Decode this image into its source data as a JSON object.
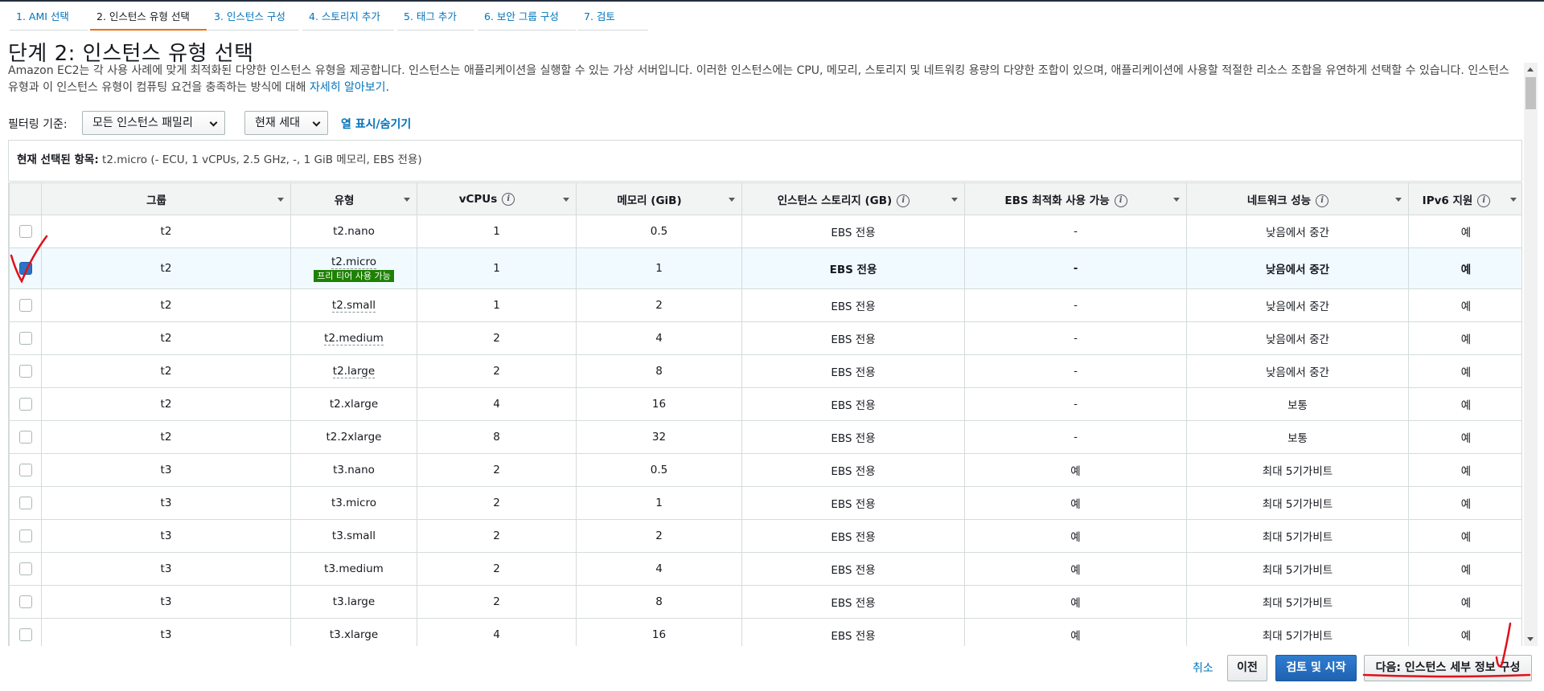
{
  "wizard_steps": [
    {
      "label": "1. AMI 선택"
    },
    {
      "label": "2. 인스턴스 유형 선택"
    },
    {
      "label": "3. 인스턴스 구성"
    },
    {
      "label": "4. 스토리지 추가"
    },
    {
      "label": "5. 태그 추가"
    },
    {
      "label": "6. 보안 그룹 구성"
    },
    {
      "label": "7. 검토"
    }
  ],
  "page": {
    "title": "단계 2: 인스턴스 유형 선택",
    "description": "Amazon EC2는 각 사용 사례에 맞게 최적화된 다양한 인스턴스 유형을 제공합니다. 인스턴스는 애플리케이션을 실행할 수 있는 가상 서버입니다. 이러한 인스턴스에는 CPU, 메모리, 스토리지 및 네트워킹 용량의 다양한 조합이 있으며, 애플리케이션에 사용할 적절한 리소스 조합을 유연하게 선택할 수 있습니다. 인스턴스 유형과 이 인스턴스 유형이 컴퓨팅 요건을 충족하는 방식에 대해 ",
    "learn_more": "자세히 알아보기",
    "desc_end": "."
  },
  "filter": {
    "label": "필터링 기준:",
    "family_select": "모든 인스턴스 패밀리",
    "generation_select": "현재 세대",
    "toggle_columns": "열 표시/숨기기"
  },
  "selected": {
    "label": "현재 선택된 항목:",
    "value": "t2.micro (- ECU, 1 vCPUs, 2.5 GHz, -, 1 GiB 메모리, EBS 전용)"
  },
  "table": {
    "headers": [
      "그룹",
      "유형",
      "vCPUs",
      "메모리 (GiB)",
      "인스턴스 스토리지 (GB)",
      "EBS 최적화 사용 가능",
      "네트워크 성능",
      "IPv6 지원"
    ],
    "info_icon": "i",
    "free_tier_badge": "프리 티어 사용 가능",
    "rows": [
      {
        "group": "t2",
        "type": "t2.nano",
        "vcpus": "1",
        "memory": "0.5",
        "storage": "EBS 전용",
        "ebs": "-",
        "network": "낮음에서 중간",
        "ipv6": "예",
        "selected": false
      },
      {
        "group": "t2",
        "type": "t2.micro",
        "vcpus": "1",
        "memory": "1",
        "storage": "EBS 전용",
        "ebs": "-",
        "network": "낮음에서 중간",
        "ipv6": "예",
        "selected": true
      },
      {
        "group": "t2",
        "type": "t2.small",
        "vcpus": "1",
        "memory": "2",
        "storage": "EBS 전용",
        "ebs": "-",
        "network": "낮음에서 중간",
        "ipv6": "예",
        "selected": false
      },
      {
        "group": "t2",
        "type": "t2.medium",
        "vcpus": "2",
        "memory": "4",
        "storage": "EBS 전용",
        "ebs": "-",
        "network": "낮음에서 중간",
        "ipv6": "예",
        "selected": false
      },
      {
        "group": "t2",
        "type": "t2.large",
        "vcpus": "2",
        "memory": "8",
        "storage": "EBS 전용",
        "ebs": "-",
        "network": "낮음에서 중간",
        "ipv6": "예",
        "selected": false
      },
      {
        "group": "t2",
        "type": "t2.xlarge",
        "vcpus": "4",
        "memory": "16",
        "storage": "EBS 전용",
        "ebs": "-",
        "network": "보통",
        "ipv6": "예",
        "selected": false
      },
      {
        "group": "t2",
        "type": "t2.2xlarge",
        "vcpus": "8",
        "memory": "32",
        "storage": "EBS 전용",
        "ebs": "-",
        "network": "보통",
        "ipv6": "예",
        "selected": false
      },
      {
        "group": "t3",
        "type": "t3.nano",
        "vcpus": "2",
        "memory": "0.5",
        "storage": "EBS 전용",
        "ebs": "예",
        "network": "최대 5기가비트",
        "ipv6": "예",
        "selected": false
      },
      {
        "group": "t3",
        "type": "t3.micro",
        "vcpus": "2",
        "memory": "1",
        "storage": "EBS 전용",
        "ebs": "예",
        "network": "최대 5기가비트",
        "ipv6": "예",
        "selected": false
      },
      {
        "group": "t3",
        "type": "t3.small",
        "vcpus": "2",
        "memory": "2",
        "storage": "EBS 전용",
        "ebs": "예",
        "network": "최대 5기가비트",
        "ipv6": "예",
        "selected": false
      },
      {
        "group": "t3",
        "type": "t3.medium",
        "vcpus": "2",
        "memory": "4",
        "storage": "EBS 전용",
        "ebs": "예",
        "network": "최대 5기가비트",
        "ipv6": "예",
        "selected": false
      },
      {
        "group": "t3",
        "type": "t3.large",
        "vcpus": "2",
        "memory": "8",
        "storage": "EBS 전용",
        "ebs": "예",
        "network": "최대 5기가비트",
        "ipv6": "예",
        "selected": false
      },
      {
        "group": "t3",
        "type": "t3.xlarge",
        "vcpus": "4",
        "memory": "16",
        "storage": "EBS 전용",
        "ebs": "예",
        "network": "최대 5기가비트",
        "ipv6": "예",
        "selected": false
      }
    ]
  },
  "footer": {
    "cancel": "취소",
    "previous": "이전",
    "review_launch": "검토 및 시작",
    "next": "다음: 인스턴스 세부 정보 구성"
  },
  "colors": {
    "link": "#0073bb",
    "primary_button": "#1f62b0",
    "free_tier": "#1d8102",
    "annotation": "#e0101a"
  }
}
